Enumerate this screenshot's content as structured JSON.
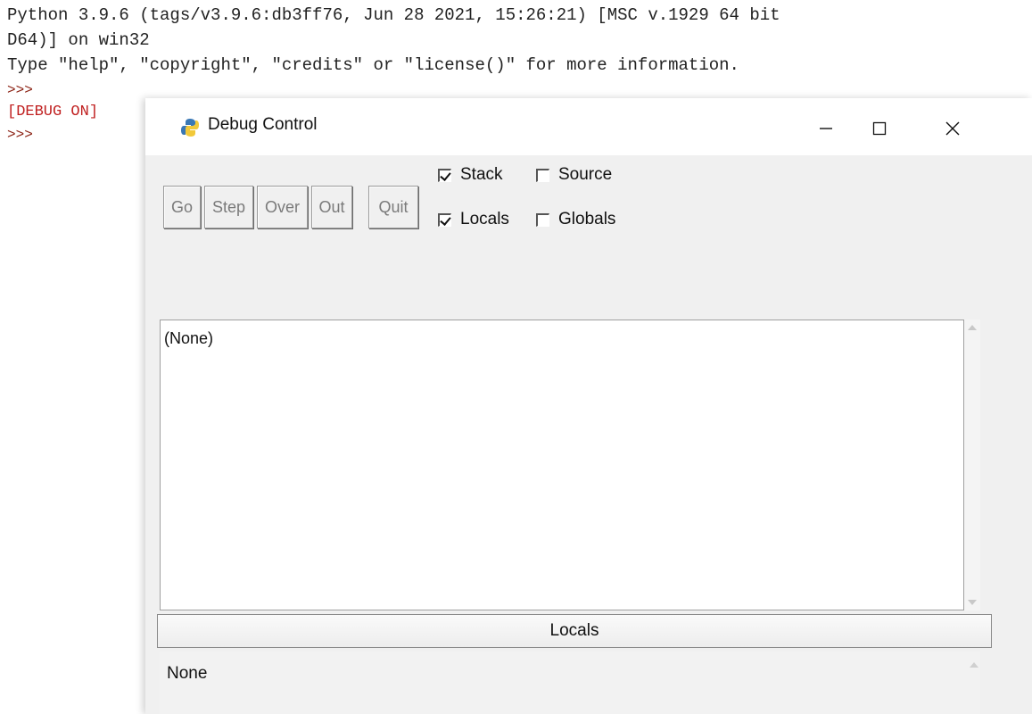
{
  "shell": {
    "lines": [
      "Python 3.9.6 (tags/v3.9.6:db3ff76, Jun 28 2021, 15:26:21) [MSC v.1929 64 bit",
      "D64)] on win32",
      "Type \"help\", \"copyright\", \"credits\" or \"license()\" for more information."
    ],
    "prompt1": ">>>",
    "debug_on": "[DEBUG ON]",
    "prompt2": ">>>"
  },
  "window": {
    "title": "Debug Control",
    "icon": "python-icon",
    "controls": {
      "minimize": "—",
      "maximize": "☐",
      "close": "✕"
    }
  },
  "toolbar": {
    "go": "Go",
    "step": "Step",
    "over": "Over",
    "out": "Out",
    "quit": "Quit"
  },
  "options": {
    "stack": {
      "label": "Stack",
      "checked": true
    },
    "source": {
      "label": "Source",
      "checked": false
    },
    "locals": {
      "label": "Locals",
      "checked": true
    },
    "globals": {
      "label": "Globals",
      "checked": false
    }
  },
  "stack_panel": {
    "content": "(None)"
  },
  "locals_section": {
    "header": "Locals",
    "content": "None"
  }
}
